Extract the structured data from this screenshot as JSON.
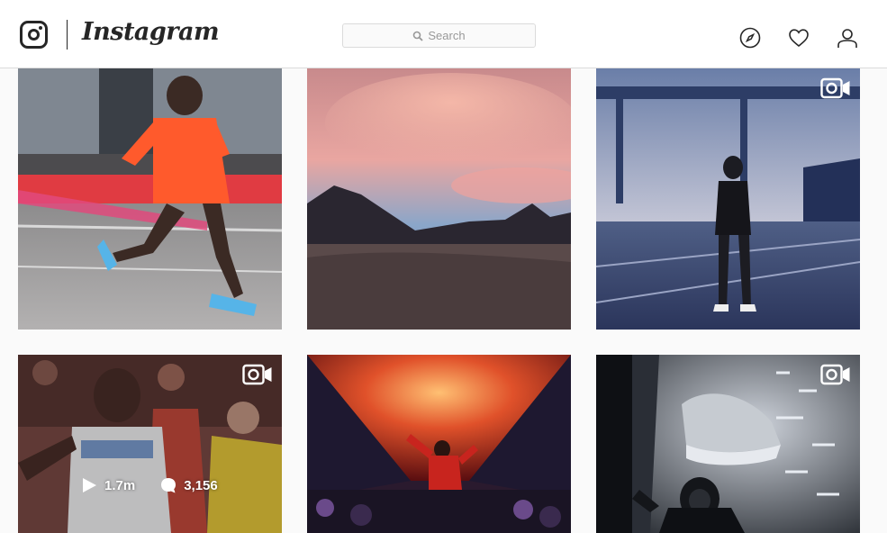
{
  "app": {
    "wordmark": "Instagram"
  },
  "search": {
    "placeholder": "Search"
  },
  "nav": {
    "icons": [
      "explore-icon",
      "heart-icon",
      "profile-icon"
    ]
  },
  "posts": [
    {
      "type": "photo",
      "video": false,
      "description_icon": "image"
    },
    {
      "type": "photo",
      "video": false,
      "description_icon": "image"
    },
    {
      "type": "video",
      "video": true,
      "description_icon": "video-camera-icon"
    },
    {
      "type": "video",
      "video": true,
      "description_icon": "video-camera-icon",
      "hover_stats": {
        "views": "1.7m",
        "comments": "3,156"
      }
    },
    {
      "type": "photo",
      "video": false,
      "description_icon": "image"
    },
    {
      "type": "video",
      "video": true,
      "description_icon": "video-camera-icon"
    }
  ],
  "colors": {
    "border": "#dbdbdb",
    "text": "#262626",
    "background": "#fafafa"
  }
}
